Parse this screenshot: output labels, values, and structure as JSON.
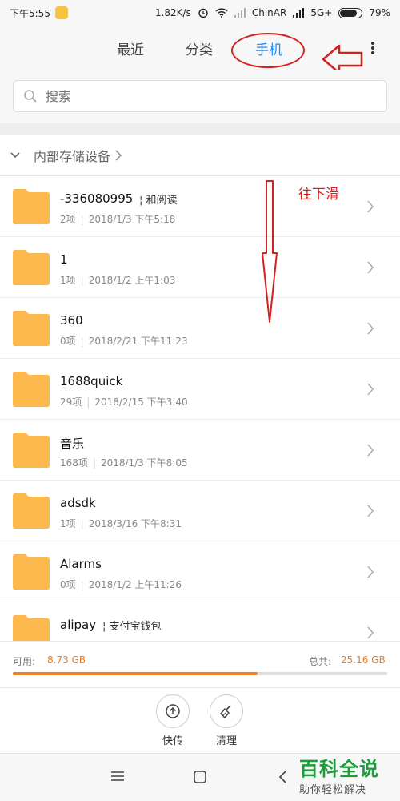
{
  "status": {
    "time": "下午5:55",
    "speed": "1.82K/s",
    "carrier": "ChinAR",
    "network": "5G+",
    "battery": "79%",
    "battery_level": 0.79
  },
  "tabs": [
    {
      "label": "最近"
    },
    {
      "label": "分类"
    },
    {
      "label": "手机"
    }
  ],
  "search": {
    "placeholder": "搜索"
  },
  "breadcrumb": {
    "label": "内部存储设备"
  },
  "annotation": {
    "scroll_hint": "往下滑"
  },
  "folders": [
    {
      "name": "-336080995",
      "tag": "和阅读",
      "count": "2项",
      "date": "2018/1/3 下午5:18"
    },
    {
      "name": "1",
      "tag": "",
      "count": "1项",
      "date": "2018/1/2 上午1:03"
    },
    {
      "name": "360",
      "tag": "",
      "count": "0项",
      "date": "2018/2/21 下午11:23"
    },
    {
      "name": "1688quick",
      "tag": "",
      "count": "29项",
      "date": "2018/2/15 下午3:40"
    },
    {
      "name": "音乐",
      "tag": "",
      "count": "168项",
      "date": "2018/1/3 下午8:05"
    },
    {
      "name": "adsdk",
      "tag": "",
      "count": "1项",
      "date": "2018/3/16 下午8:31"
    },
    {
      "name": "Alarms",
      "tag": "",
      "count": "0项",
      "date": "2018/1/2 上午11:26"
    },
    {
      "name": "alipay",
      "tag": "支付宝钱包",
      "count": "",
      "date": ""
    }
  ],
  "storage": {
    "available_label": "可用:",
    "available": "8.73 GB",
    "total_label": "总共:",
    "total": "25.16 GB",
    "used_fraction": 0.653
  },
  "actions": {
    "transfer": "快传",
    "clean": "清理"
  },
  "watermark": {
    "title": "百科全说",
    "subtitle": "助你轻松解决"
  },
  "colors": {
    "accent": "#1a8cff",
    "storage": "#ef7d21",
    "folder": "#fdb94e",
    "annotation": "#d62020"
  }
}
